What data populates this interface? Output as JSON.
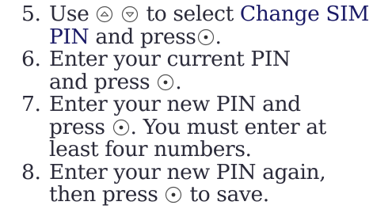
{
  "steps": [
    {
      "number": "5.",
      "t1": "Use",
      "t2": "to select",
      "highlight": "Change SIM PIN",
      "t3": "and press",
      "t4": "."
    },
    {
      "number": "6.",
      "t1": "Enter your current PIN",
      "t2": "and press",
      "t3": "."
    },
    {
      "number": "7.",
      "t1": "Enter your new PIN and",
      "t2": "press",
      "t3": ". You must enter at least four numbers."
    },
    {
      "number": "8.",
      "t1": "Enter your new PIN again,",
      "t2": "then press",
      "t3": "to save."
    }
  ],
  "icons": {
    "up": "nav-up-icon",
    "down": "nav-down-icon",
    "center": "nav-center-icon"
  }
}
